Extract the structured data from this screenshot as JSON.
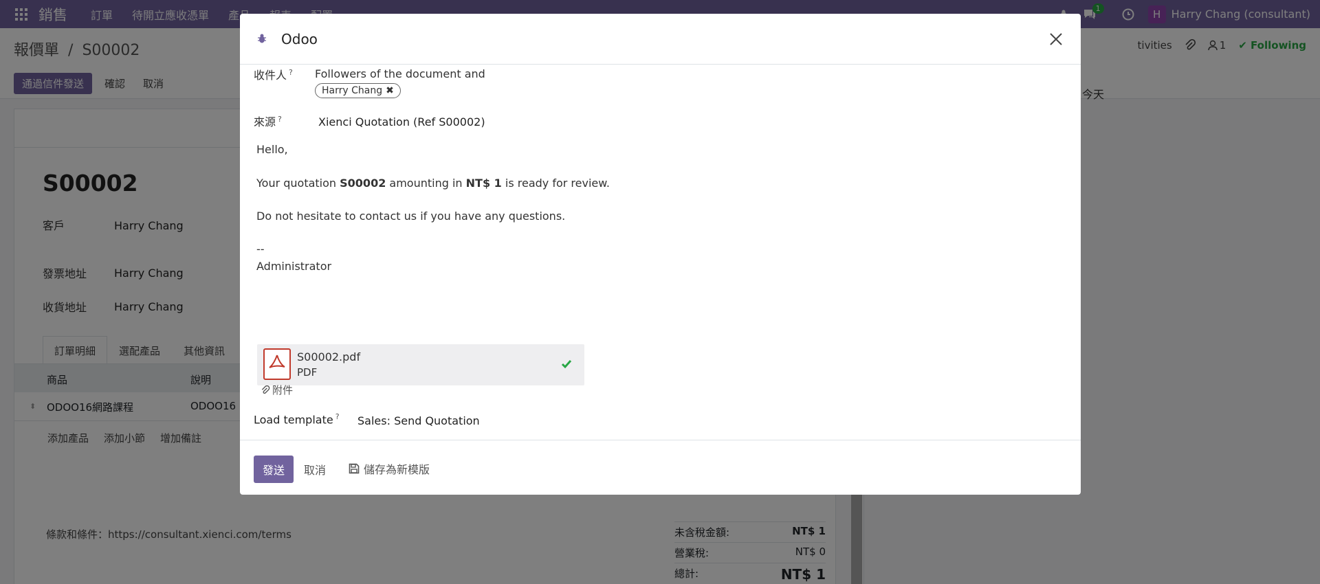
{
  "navbar": {
    "brand": "銷售",
    "menu": [
      "訂單",
      "待開立應收憑單",
      "產品",
      "報表",
      "配置"
    ],
    "chat_badge": "1",
    "avatar_letter": "H",
    "user_name": "Harry Chang (consultant)"
  },
  "control_panel": {
    "breadcrumb_parent": "報價單",
    "breadcrumb_sep": "/",
    "breadcrumb_current": "S00002",
    "btn_send_email": "通過信件發送",
    "btn_confirm": "確認",
    "btn_cancel": "取消",
    "activities": "tivities",
    "follower_count": "1",
    "following": "Following"
  },
  "form": {
    "record_name": "S00002",
    "customer_label": "客戶",
    "customer": "Harry Chang",
    "invoice_addr_label": "發票地址",
    "invoice_addr": "Harry Chang",
    "delivery_addr_label": "收貨地址",
    "delivery_addr": "Harry Chang",
    "tabs": [
      "訂單明細",
      "選配產品",
      "其他資訊"
    ],
    "col_product": "商品",
    "col_desc": "說明",
    "row_product": "ODOO16網路課程",
    "row_desc": "ODOO16",
    "add_product": "添加產品",
    "add_section": "添加小節",
    "add_note": "增加備註",
    "terms": "條款和條件：https://consultant.xienci.com/terms",
    "untaxed_label": "未含稅金額:",
    "untaxed": "NT$ 1",
    "tax_label": "營業稅:",
    "tax": "NT$ 0",
    "total_label": "總計:",
    "total": "NT$ 1"
  },
  "chatter": {
    "today": "今天"
  },
  "modal": {
    "title": "Odoo",
    "recipients_label": "收件人",
    "help_mark": "?",
    "recipients_text": "Followers of the document and",
    "recipient_tag": "Harry Chang",
    "source_label": "來源",
    "source_value": "Xienci Quotation (Ref S00002)",
    "body_hello": "Hello,",
    "body_q_pre": "Your quotation ",
    "body_q_ref": "S00002",
    "body_q_mid": " amounting in ",
    "body_q_amount": "NT$ 1",
    "body_q_post": " is ready for review.",
    "body_contact": "Do not hesitate to contact us if you have any questions.",
    "body_dash": "--",
    "body_sign": "Administrator",
    "attachment_name": "S00002.pdf",
    "attachment_type": "PDF",
    "attach_link": "附件",
    "template_label": "Load template",
    "template_value": "Sales: Send Quotation",
    "send_btn": "發送",
    "cancel_btn": "取消",
    "save_template_btn": "儲存為新模版"
  }
}
